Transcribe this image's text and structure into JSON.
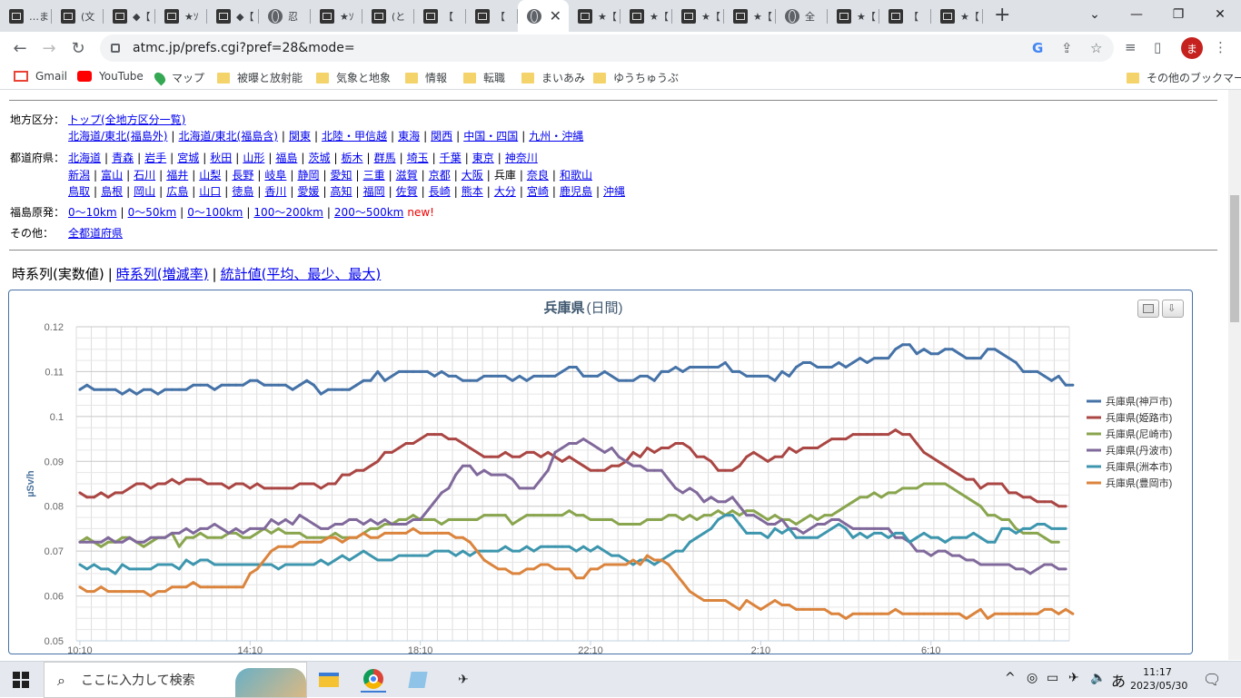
{
  "browser": {
    "tabs": [
      {
        "label": "…ま",
        "icon": "dark-icon"
      },
      {
        "label": "(文",
        "icon": "dark-icon"
      },
      {
        "label": "◆【",
        "icon": "dark-icon"
      },
      {
        "label": "★ｿ",
        "icon": "dark-icon"
      },
      {
        "label": "◆【",
        "icon": "dark-icon"
      },
      {
        "label": "忍",
        "icon": "globe-icon"
      },
      {
        "label": "★ｿ",
        "icon": "dark-icon"
      },
      {
        "label": "(と",
        "icon": "dark-icon"
      },
      {
        "label": "【",
        "icon": "dark-icon"
      },
      {
        "label": "【",
        "icon": "dark-icon"
      },
      {
        "label": "",
        "icon": "globe-icon",
        "active": true
      },
      {
        "label": "★【",
        "icon": "dark-icon"
      },
      {
        "label": "★【",
        "icon": "dark-icon"
      },
      {
        "label": "★【",
        "icon": "dark-icon"
      },
      {
        "label": "★【",
        "icon": "dark-icon"
      },
      {
        "label": "全",
        "icon": "globe-icon"
      },
      {
        "label": "★【",
        "icon": "dark-icon"
      },
      {
        "label": "【",
        "icon": "dark-icon"
      },
      {
        "label": "★【",
        "icon": "dark-icon"
      }
    ],
    "url": "atmc.jp/prefs.cgi?pref=28&mode=",
    "avatar_letter": "ま",
    "bookmarks": [
      {
        "label": "Gmail",
        "icon": "gmail-icon"
      },
      {
        "label": "YouTube",
        "icon": "youtube-icon"
      },
      {
        "label": "マップ",
        "icon": "maps-icon"
      },
      {
        "label": "被曝と放射能",
        "icon": "folder-icon"
      },
      {
        "label": "気象と地象",
        "icon": "folder-icon"
      },
      {
        "label": "情報",
        "icon": "folder-icon"
      },
      {
        "label": "転職",
        "icon": "folder-icon"
      },
      {
        "label": "まいあみ",
        "icon": "folder-icon"
      },
      {
        "label": "ゆうちゅうぶ",
        "icon": "folder-icon"
      }
    ],
    "other_bookmarks": "その他のブックマーク"
  },
  "nav": {
    "region_label": "地方区分：",
    "region_top": "トップ(全地方区分一覧)",
    "regions": [
      "北海道/東北(福島外)",
      "北海道/東北(福島含)",
      "関東",
      "北陸・甲信越",
      "東海",
      "関西",
      "中国・四国",
      "九州・沖縄"
    ],
    "pref_label": "都道府県：",
    "pref_row1": [
      "北海道",
      "青森",
      "岩手",
      "宮城",
      "秋田",
      "山形",
      "福島",
      "茨城",
      "栃木",
      "群馬",
      "埼玉",
      "千葉",
      "東京",
      "神奈川"
    ],
    "pref_row2": [
      "新潟",
      "富山",
      "石川",
      "福井",
      "山梨",
      "長野",
      "岐阜",
      "静岡",
      "愛知",
      "三重",
      "滋賀",
      "京都",
      "大阪",
      "兵庫",
      "奈良",
      "和歌山"
    ],
    "pref_row3": [
      "鳥取",
      "島根",
      "岡山",
      "広島",
      "山口",
      "徳島",
      "香川",
      "愛媛",
      "高知",
      "福岡",
      "佐賀",
      "長崎",
      "熊本",
      "大分",
      "宮崎",
      "鹿児島",
      "沖縄"
    ],
    "current_pref": "兵庫",
    "fukushima_label": "福島原発：",
    "fukushima_links": [
      "0〜10km",
      "0〜50km",
      "0〜100km",
      "100〜200km",
      "200〜500km"
    ],
    "new_badge": "new!",
    "other_label": "その他：",
    "other_link": "全都道府県"
  },
  "view_tabs": {
    "current": "時系列(実数値)",
    "links": [
      "時系列(増減率)",
      "統計値(平均、最少、最大)"
    ]
  },
  "chart_data": {
    "type": "line",
    "title": "兵庫県",
    "subtitle_suffix": "(日間)",
    "ylabel": "µSv/h",
    "ylim": [
      0.05,
      0.12
    ],
    "yticks": [
      "0.05",
      "0.06",
      "0.07",
      "0.08",
      "0.09",
      "0.1",
      "0.11",
      "0.12"
    ],
    "xticks": [
      "10:10",
      "14:10",
      "18:10",
      "22:10",
      "2:10",
      "6:10"
    ],
    "x_points": 140,
    "series": [
      {
        "name": "兵庫県(神戸市)",
        "color": "#4572a7",
        "values": [
          0.106,
          0.107,
          0.106,
          0.106,
          0.106,
          0.106,
          0.105,
          0.106,
          0.105,
          0.106,
          0.106,
          0.105,
          0.106,
          0.106,
          0.106,
          0.106,
          0.107,
          0.107,
          0.107,
          0.106,
          0.107,
          0.107,
          0.107,
          0.107,
          0.108,
          0.108,
          0.107,
          0.107,
          0.107,
          0.107,
          0.106,
          0.107,
          0.108,
          0.107,
          0.105,
          0.106,
          0.106,
          0.106,
          0.106,
          0.107,
          0.108,
          0.108,
          0.11,
          0.108,
          0.109,
          0.11,
          0.11,
          0.11,
          0.11,
          0.11,
          0.109,
          0.11,
          0.109,
          0.109,
          0.108,
          0.108,
          0.108,
          0.109,
          0.109,
          0.109,
          0.109,
          0.108,
          0.109,
          0.108,
          0.109,
          0.109,
          0.109,
          0.109,
          0.11,
          0.111,
          0.111,
          0.109,
          0.109,
          0.109,
          0.11,
          0.109,
          0.108,
          0.108,
          0.108,
          0.109,
          0.109,
          0.108,
          0.11,
          0.11,
          0.111,
          0.11,
          0.111,
          0.111,
          0.111,
          0.111,
          0.111,
          0.112,
          0.11,
          0.11,
          0.109,
          0.109,
          0.109,
          0.109,
          0.108,
          0.11,
          0.109,
          0.111,
          0.112,
          0.112,
          0.111,
          0.111,
          0.111,
          0.112,
          0.111,
          0.112,
          0.113,
          0.112,
          0.113,
          0.113,
          0.113,
          0.115,
          0.116,
          0.116,
          0.114,
          0.115,
          0.114,
          0.114,
          0.115,
          0.115,
          0.114,
          0.113,
          0.113,
          0.113,
          0.115,
          0.115,
          0.114,
          0.113,
          0.112,
          0.11,
          0.11,
          0.11,
          0.109,
          0.108,
          0.109,
          0.107,
          0.107
        ]
      },
      {
        "name": "兵庫県(姫路市)",
        "color": "#aa4643",
        "values": [
          0.083,
          0.082,
          0.082,
          0.083,
          0.082,
          0.083,
          0.083,
          0.084,
          0.085,
          0.085,
          0.084,
          0.085,
          0.085,
          0.086,
          0.085,
          0.086,
          0.086,
          0.086,
          0.085,
          0.085,
          0.085,
          0.084,
          0.085,
          0.085,
          0.084,
          0.085,
          0.084,
          0.084,
          0.084,
          0.084,
          0.084,
          0.085,
          0.085,
          0.085,
          0.084,
          0.085,
          0.085,
          0.087,
          0.087,
          0.088,
          0.088,
          0.089,
          0.09,
          0.092,
          0.092,
          0.093,
          0.094,
          0.094,
          0.095,
          0.096,
          0.096,
          0.096,
          0.095,
          0.095,
          0.094,
          0.093,
          0.092,
          0.091,
          0.091,
          0.091,
          0.092,
          0.091,
          0.091,
          0.092,
          0.092,
          0.091,
          0.092,
          0.091,
          0.09,
          0.091,
          0.09,
          0.089,
          0.088,
          0.088,
          0.088,
          0.089,
          0.089,
          0.09,
          0.092,
          0.091,
          0.093,
          0.092,
          0.093,
          0.093,
          0.094,
          0.094,
          0.093,
          0.091,
          0.091,
          0.09,
          0.088,
          0.088,
          0.088,
          0.089,
          0.091,
          0.092,
          0.091,
          0.09,
          0.091,
          0.091,
          0.093,
          0.092,
          0.093,
          0.093,
          0.093,
          0.094,
          0.095,
          0.095,
          0.095,
          0.096,
          0.096,
          0.096,
          0.096,
          0.096,
          0.096,
          0.097,
          0.096,
          0.096,
          0.094,
          0.092,
          0.091,
          0.09,
          0.089,
          0.088,
          0.087,
          0.086,
          0.086,
          0.084,
          0.085,
          0.085,
          0.085,
          0.083,
          0.083,
          0.082,
          0.082,
          0.081,
          0.081,
          0.081,
          0.08,
          0.08
        ]
      },
      {
        "name": "兵庫県(尼崎市)",
        "color": "#89a54e",
        "values": [
          0.072,
          0.073,
          0.072,
          0.071,
          0.072,
          0.072,
          0.073,
          0.073,
          0.072,
          0.071,
          0.072,
          0.073,
          0.073,
          0.074,
          0.071,
          0.073,
          0.073,
          0.074,
          0.073,
          0.073,
          0.073,
          0.074,
          0.074,
          0.073,
          0.073,
          0.074,
          0.075,
          0.074,
          0.075,
          0.074,
          0.074,
          0.074,
          0.073,
          0.073,
          0.073,
          0.073,
          0.074,
          0.073,
          0.073,
          0.073,
          0.074,
          0.075,
          0.075,
          0.076,
          0.076,
          0.077,
          0.077,
          0.078,
          0.077,
          0.077,
          0.077,
          0.076,
          0.077,
          0.077,
          0.077,
          0.077,
          0.077,
          0.078,
          0.078,
          0.078,
          0.078,
          0.076,
          0.077,
          0.078,
          0.078,
          0.078,
          0.078,
          0.078,
          0.078,
          0.079,
          0.078,
          0.078,
          0.077,
          0.077,
          0.077,
          0.077,
          0.076,
          0.076,
          0.076,
          0.076,
          0.077,
          0.077,
          0.077,
          0.078,
          0.078,
          0.077,
          0.078,
          0.077,
          0.078,
          0.078,
          0.079,
          0.078,
          0.079,
          0.078,
          0.079,
          0.079,
          0.078,
          0.077,
          0.078,
          0.077,
          0.077,
          0.076,
          0.077,
          0.078,
          0.077,
          0.078,
          0.078,
          0.079,
          0.08,
          0.081,
          0.082,
          0.082,
          0.083,
          0.082,
          0.083,
          0.083,
          0.084,
          0.084,
          0.084,
          0.085,
          0.085,
          0.085,
          0.085,
          0.084,
          0.083,
          0.082,
          0.081,
          0.08,
          0.078,
          0.078,
          0.077,
          0.077,
          0.075,
          0.074,
          0.074,
          0.074,
          0.073,
          0.072,
          0.072
        ]
      },
      {
        "name": "兵庫県(丹波市)",
        "color": "#80699b",
        "values": [
          0.072,
          0.072,
          0.072,
          0.072,
          0.073,
          0.072,
          0.072,
          0.073,
          0.072,
          0.072,
          0.073,
          0.073,
          0.073,
          0.074,
          0.074,
          0.075,
          0.074,
          0.075,
          0.075,
          0.076,
          0.075,
          0.074,
          0.075,
          0.074,
          0.075,
          0.075,
          0.075,
          0.077,
          0.076,
          0.077,
          0.076,
          0.078,
          0.077,
          0.076,
          0.075,
          0.075,
          0.076,
          0.076,
          0.077,
          0.077,
          0.076,
          0.077,
          0.076,
          0.077,
          0.076,
          0.076,
          0.076,
          0.077,
          0.077,
          0.079,
          0.081,
          0.083,
          0.084,
          0.087,
          0.089,
          0.089,
          0.087,
          0.088,
          0.087,
          0.087,
          0.087,
          0.086,
          0.084,
          0.084,
          0.084,
          0.086,
          0.088,
          0.092,
          0.093,
          0.094,
          0.094,
          0.095,
          0.094,
          0.093,
          0.092,
          0.093,
          0.091,
          0.09,
          0.089,
          0.089,
          0.088,
          0.088,
          0.088,
          0.086,
          0.084,
          0.083,
          0.084,
          0.083,
          0.081,
          0.082,
          0.081,
          0.081,
          0.082,
          0.08,
          0.078,
          0.078,
          0.077,
          0.076,
          0.076,
          0.077,
          0.075,
          0.075,
          0.074,
          0.075,
          0.076,
          0.076,
          0.077,
          0.077,
          0.076,
          0.075,
          0.075,
          0.075,
          0.075,
          0.075,
          0.075,
          0.073,
          0.073,
          0.072,
          0.07,
          0.07,
          0.069,
          0.07,
          0.07,
          0.069,
          0.069,
          0.068,
          0.068,
          0.067,
          0.067,
          0.067,
          0.067,
          0.067,
          0.066,
          0.066,
          0.065,
          0.066,
          0.067,
          0.067,
          0.066,
          0.066
        ]
      },
      {
        "name": "兵庫県(洲本市)",
        "color": "#3d96ae",
        "values": [
          0.067,
          0.066,
          0.067,
          0.066,
          0.066,
          0.065,
          0.067,
          0.066,
          0.066,
          0.066,
          0.066,
          0.067,
          0.067,
          0.067,
          0.066,
          0.068,
          0.067,
          0.068,
          0.068,
          0.067,
          0.067,
          0.067,
          0.067,
          0.067,
          0.067,
          0.067,
          0.067,
          0.067,
          0.066,
          0.067,
          0.067,
          0.067,
          0.067,
          0.067,
          0.068,
          0.067,
          0.068,
          0.069,
          0.068,
          0.069,
          0.07,
          0.069,
          0.068,
          0.068,
          0.068,
          0.069,
          0.069,
          0.069,
          0.069,
          0.069,
          0.07,
          0.07,
          0.07,
          0.069,
          0.07,
          0.069,
          0.07,
          0.07,
          0.07,
          0.07,
          0.071,
          0.07,
          0.07,
          0.071,
          0.07,
          0.071,
          0.071,
          0.071,
          0.071,
          0.071,
          0.07,
          0.071,
          0.07,
          0.071,
          0.07,
          0.069,
          0.069,
          0.068,
          0.067,
          0.068,
          0.068,
          0.067,
          0.068,
          0.069,
          0.07,
          0.07,
          0.072,
          0.073,
          0.074,
          0.075,
          0.077,
          0.078,
          0.078,
          0.076,
          0.074,
          0.074,
          0.074,
          0.073,
          0.075,
          0.074,
          0.075,
          0.073,
          0.073,
          0.073,
          0.073,
          0.074,
          0.075,
          0.076,
          0.075,
          0.073,
          0.074,
          0.073,
          0.074,
          0.074,
          0.073,
          0.074,
          0.074,
          0.072,
          0.073,
          0.074,
          0.073,
          0.073,
          0.072,
          0.073,
          0.073,
          0.073,
          0.074,
          0.073,
          0.072,
          0.072,
          0.075,
          0.075,
          0.074,
          0.075,
          0.075,
          0.076,
          0.076,
          0.075,
          0.075,
          0.075
        ]
      },
      {
        "name": "兵庫県(豊岡市)",
        "color": "#db843d",
        "values": [
          0.062,
          0.061,
          0.061,
          0.062,
          0.061,
          0.061,
          0.061,
          0.061,
          0.061,
          0.061,
          0.06,
          0.061,
          0.061,
          0.062,
          0.062,
          0.062,
          0.063,
          0.062,
          0.062,
          0.062,
          0.062,
          0.062,
          0.062,
          0.062,
          0.065,
          0.066,
          0.068,
          0.07,
          0.071,
          0.071,
          0.071,
          0.072,
          0.072,
          0.072,
          0.072,
          0.073,
          0.073,
          0.072,
          0.073,
          0.073,
          0.074,
          0.073,
          0.073,
          0.074,
          0.074,
          0.074,
          0.074,
          0.075,
          0.074,
          0.074,
          0.074,
          0.074,
          0.074,
          0.073,
          0.073,
          0.072,
          0.07,
          0.068,
          0.067,
          0.066,
          0.066,
          0.065,
          0.065,
          0.066,
          0.066,
          0.067,
          0.067,
          0.066,
          0.066,
          0.066,
          0.064,
          0.064,
          0.066,
          0.066,
          0.067,
          0.067,
          0.067,
          0.067,
          0.068,
          0.067,
          0.069,
          0.068,
          0.068,
          0.067,
          0.065,
          0.063,
          0.061,
          0.06,
          0.059,
          0.059,
          0.059,
          0.059,
          0.058,
          0.057,
          0.059,
          0.058,
          0.057,
          0.058,
          0.059,
          0.058,
          0.058,
          0.057,
          0.057,
          0.057,
          0.057,
          0.057,
          0.056,
          0.056,
          0.055,
          0.056,
          0.056,
          0.056,
          0.056,
          0.056,
          0.056,
          0.057,
          0.056,
          0.056,
          0.056,
          0.056,
          0.056,
          0.056,
          0.056,
          0.056,
          0.056,
          0.055,
          0.056,
          0.057,
          0.055,
          0.056,
          0.056,
          0.056,
          0.056,
          0.056,
          0.056,
          0.056,
          0.057,
          0.057,
          0.056,
          0.057,
          0.056
        ]
      }
    ]
  },
  "taskbar": {
    "search_placeholder": "ここに入力して検索",
    "time": "11:17",
    "date": "2023/05/30",
    "ime": "あ"
  }
}
